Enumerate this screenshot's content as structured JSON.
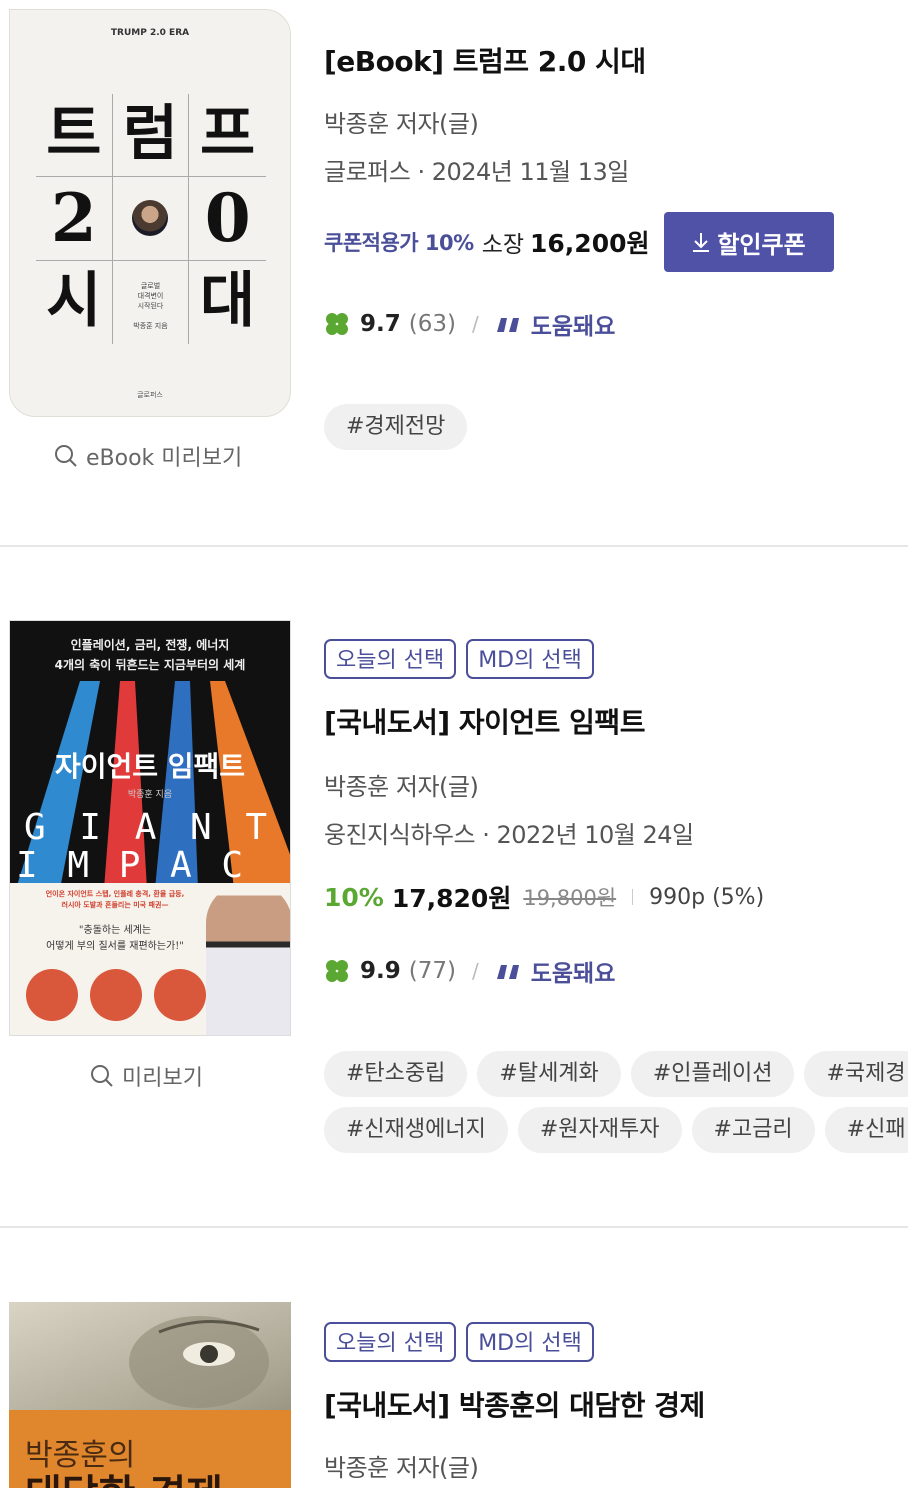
{
  "items": [
    {
      "cover_header": "TRUMP 2.0 ERA",
      "cover_chars": [
        "트",
        "럼",
        "프",
        "2",
        "",
        "0",
        "시",
        "",
        "대"
      ],
      "cover_sub": [
        "글로벌",
        "대격변이",
        "시작된다"
      ],
      "cover_author": "박종훈 지음",
      "cover_publisher": "글로퍼스",
      "preview_label": "eBook 미리보기",
      "title": "[eBook] 트럼프 2.0 시대",
      "author": "박종훈 저자(글)",
      "publisher_date": "글로퍼스 · 2024년 11월 13일",
      "coupon_label": "쿠폰적용가 10%",
      "price_prefix": "소장",
      "price": "16,200원",
      "coupon_button": "할인쿠폰",
      "rating": "9.7",
      "rating_count": "(63)",
      "slash": "/",
      "helpful": "도움돼요",
      "tags": [
        [
          "#경제전망"
        ]
      ]
    },
    {
      "cover_top": [
        "인플레이션, 금리, 전쟁, 에너지",
        "4개의 축이 뒤흔드는 지금부터의 세계"
      ],
      "cover_title": "자이언트 임팩트",
      "cover_author": "박종훈 지음",
      "cover_giant": "G I A N T",
      "cover_impact": "I M P A C T",
      "cover_blurb": [
        "언이온 자이언트 스텝, 인플레 충격, 환율 급등,",
        "러시아 도발과 흔들리는 미국 패권—"
      ],
      "cover_quote": [
        "\"충돌하는 세계는",
        "어떻게 부의 질서를 재편하는가!\""
      ],
      "preview_label": "미리보기",
      "badges": [
        "오늘의 선택",
        "MD의 선택"
      ],
      "title": "[국내도서] 자이언트 임팩트",
      "author": "박종훈 저자(글)",
      "publisher_date": "웅진지식하우스 · 2022년 10월 24일",
      "discount": "10%",
      "price": "17,820원",
      "original_price": "19,800원",
      "points": "990p (5%)",
      "rating": "9.9",
      "rating_count": "(77)",
      "slash": "/",
      "helpful": "도움돼요",
      "tags": [
        [
          "#탄소중립",
          "#탈세계화",
          "#인플레이션",
          "#국제경"
        ],
        [
          "#신재생에너지",
          "#원자재투자",
          "#고금리",
          "#신패"
        ]
      ]
    },
    {
      "cover_title_1": "박종훈의",
      "cover_title_2": "대담한 경제",
      "badges": [
        "오늘의 선택",
        "MD의 선택"
      ],
      "title": "[국내도서] 박종훈의 대담한 경제",
      "author": "박종훈 저자(글)"
    }
  ],
  "colors": {
    "accent": "#4b4f9a",
    "green": "#5aa832",
    "tag_bg": "#f0f0f0"
  },
  "icons": [
    "search-icon",
    "download-icon",
    "clover-icon",
    "quote-icon"
  ]
}
